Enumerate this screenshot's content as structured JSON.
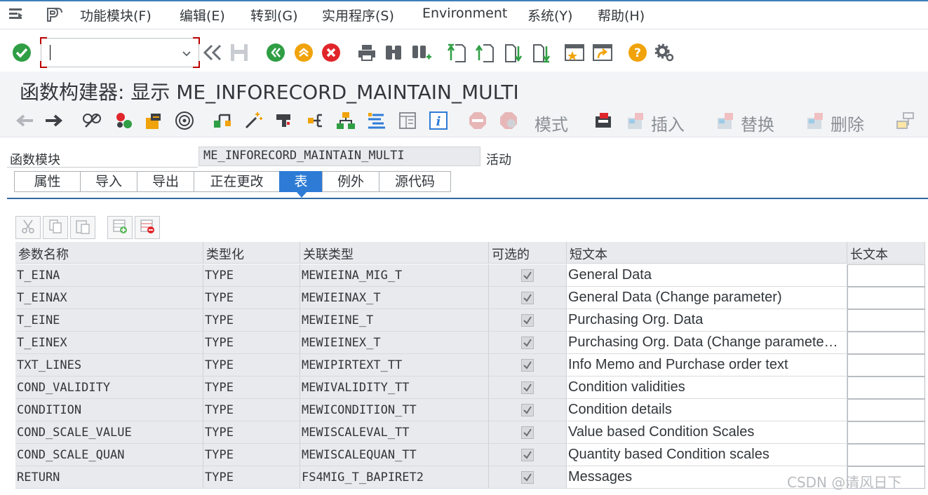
{
  "menu": {
    "items": [
      "功能模块(F)",
      "编辑(E)",
      "转到(G)",
      "实用程序(S)",
      "Environment",
      "系统(Y)",
      "帮助(H)"
    ]
  },
  "toolbar": {
    "command_value": ""
  },
  "title": "函数构建器: 显示 ME_INFORECORD_MAINTAIN_MULTI",
  "app_toolbar": {
    "mode_label": "模式",
    "insert_label": "插入",
    "replace_label": "替换",
    "delete_label": "删除"
  },
  "function_module": {
    "label": "函数模块",
    "value": "ME_INFORECORD_MAINTAIN_MULTI",
    "status": "活动"
  },
  "tabs": [
    "属性",
    "导入",
    "导出",
    "正在更改",
    "表",
    "例外",
    "源代码"
  ],
  "active_tab": "表",
  "table": {
    "headers": [
      "参数名称",
      "类型化",
      "关联类型",
      "可选的",
      "短文本",
      "长文本"
    ],
    "rows": [
      {
        "name": "T_EINA",
        "typing": "TYPE",
        "type": "MEWIEINA_MIG_T",
        "optional": true,
        "short": "General Data"
      },
      {
        "name": "T_EINAX",
        "typing": "TYPE",
        "type": "MEWIEINAX_T",
        "optional": true,
        "short": "General Data (Change parameter)"
      },
      {
        "name": "T_EINE",
        "typing": "TYPE",
        "type": "MEWIEINE_T",
        "optional": true,
        "short": "Purchasing Org. Data"
      },
      {
        "name": "T_EINEX",
        "typing": "TYPE",
        "type": "MEWIEINEX_T",
        "optional": true,
        "short": "Purchasing Org. Data (Change paramete…"
      },
      {
        "name": "TXT_LINES",
        "typing": "TYPE",
        "type": "MEWIPIRTEXT_TT",
        "optional": true,
        "short": "Info Memo and Purchase order text"
      },
      {
        "name": "COND_VALIDITY",
        "typing": "TYPE",
        "type": "MEWIVALIDITY_TT",
        "optional": true,
        "short": "Condition validities"
      },
      {
        "name": "CONDITION",
        "typing": "TYPE",
        "type": "MEWICONDITION_TT",
        "optional": true,
        "short": "Condition details"
      },
      {
        "name": "COND_SCALE_VALUE",
        "typing": "TYPE",
        "type": "MEWISCALEVAL_TT",
        "optional": true,
        "short": "Value based Condition Scales"
      },
      {
        "name": "COND_SCALE_QUAN",
        "typing": "TYPE",
        "type": "MEWISCALEQUAN_TT",
        "optional": true,
        "short": "Quantity based Condition scales"
      },
      {
        "name": "RETURN",
        "typing": "TYPE",
        "type": "FS4MIG_T_BAPIRET2",
        "optional": true,
        "short": "Messages"
      }
    ]
  },
  "watermark": "CSDN @清风日下",
  "colors": {
    "accent": "#2e7bd6",
    "ok_green": "#2f9e44",
    "nav_green": "#2f9e44",
    "nav_orange": "#f0a30a",
    "cancel_red": "#e0262b"
  }
}
